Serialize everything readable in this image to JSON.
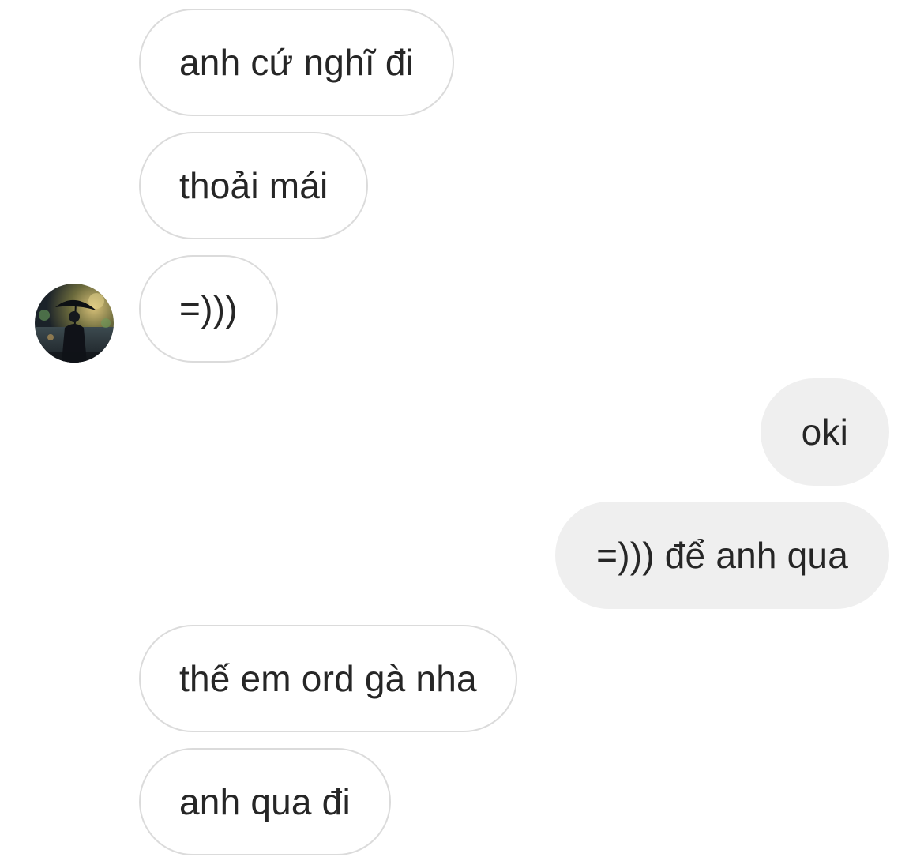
{
  "conversation": {
    "messages": [
      {
        "text": "anh cứ nghĩ đi",
        "from": "other"
      },
      {
        "text": "thoải mái",
        "from": "other"
      },
      {
        "text": "=)))",
        "from": "other"
      },
      {
        "text": "oki",
        "from": "me"
      },
      {
        "text": "=))) để anh qua",
        "from": "me"
      },
      {
        "text": "thế em ord gà nha",
        "from": "other"
      },
      {
        "text": "anh qua đi",
        "from": "other"
      }
    ]
  },
  "avatar": {
    "icon": "contact-avatar-photo",
    "colors": {
      "sky": "#1f2a33",
      "glow": "#c8b36a",
      "green": "#4f7d4a",
      "figure": "#101218"
    }
  },
  "colors": {
    "incoming_bubble": "#ffffff",
    "incoming_border": "#dbdbdb",
    "outgoing_bubble": "#efefef",
    "text": "#262626"
  }
}
